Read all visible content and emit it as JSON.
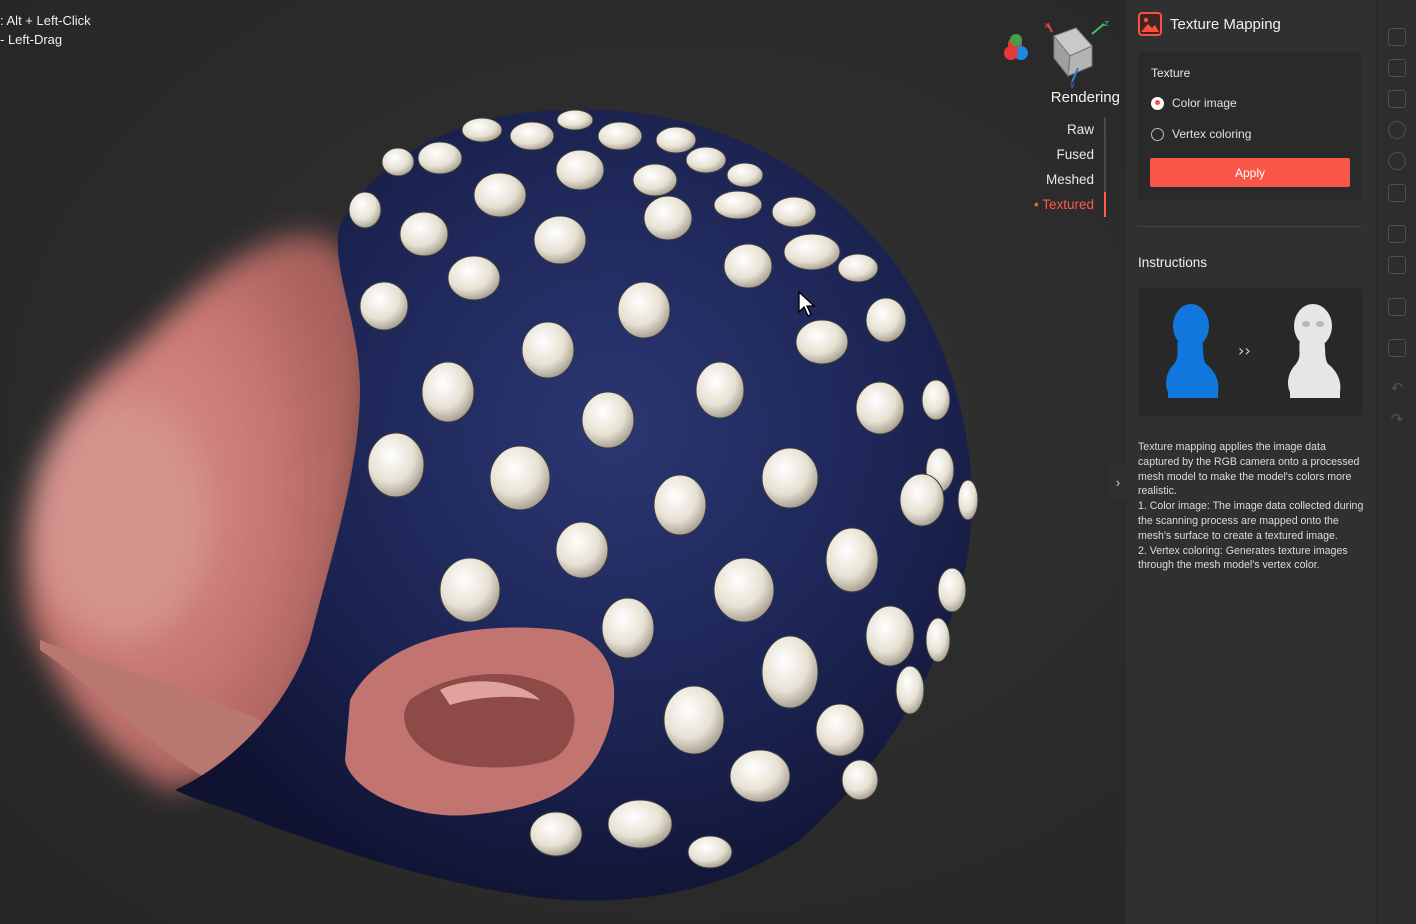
{
  "viewport": {
    "hints": [
      ": Alt + Left-Click",
      "- Left-Drag"
    ],
    "gizmo": {
      "x_label": "x",
      "y_label": "y",
      "z_label": "z"
    },
    "rendering": {
      "title": "Rendering",
      "items": [
        "Raw",
        "Fused",
        "Meshed",
        "Textured"
      ],
      "active": "Textured"
    },
    "collapse_icon": "chevron-right-icon"
  },
  "panel": {
    "title": "Texture Mapping",
    "header_icon": "image-icon",
    "texture": {
      "label": "Texture",
      "options": [
        "Color image",
        "Vertex coloring"
      ],
      "selected": "Color image",
      "apply_label": "Apply"
    },
    "instructions": {
      "title": "Instructions",
      "arrow": "››",
      "paragraphs": [
        "Texture mapping applies the image data captured by the RGB camera onto a processed mesh model to make the model's colors more realistic.",
        "1. Color image: The image data collected during the scanning process are mapped onto the mesh's surface to create a textured image.",
        "2. Vertex coloring: Generates texture images through the mesh model's vertex color."
      ]
    }
  },
  "colors": {
    "accent": "#f9564a",
    "panel_bg": "#303030",
    "viewport_bg": "#2b2b2b",
    "cap_blue": "#1c2350",
    "bust_blue": "#1177dd"
  },
  "toolbar_icons": [
    "select-icon",
    "box-icon",
    "crop-icon",
    "lasso-icon",
    "mesh-icon",
    "fill-icon",
    "layers-icon",
    "edit-icon",
    "copy-icon",
    "save-icon",
    "undo-icon",
    "redo-icon"
  ]
}
